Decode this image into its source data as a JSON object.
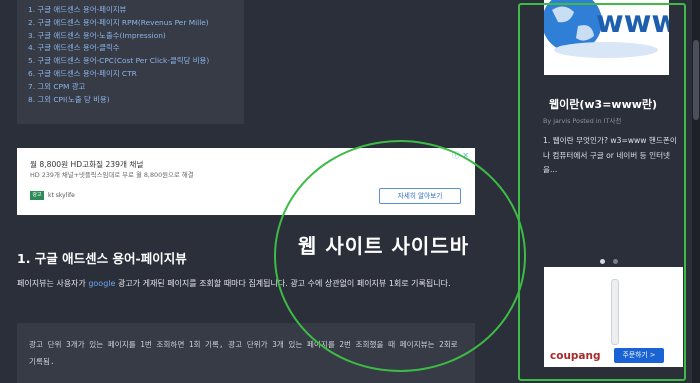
{
  "toc": {
    "items": [
      "1. 구글 애드센스 용어-페이지뷰",
      "2. 구글 애드센스 용어-페이지 RPM(Revenus Per Mille)",
      "3. 구글 애드센스 용어-노출수(Impression)",
      "4. 구글 애드센스 용어-클릭수",
      "5. 구글 애드센스 용어-CPC(Cost Per Click-클릭당 비용)",
      "6. 구글 애드센스 용어-페이지 CTR",
      "7. 그외 CPM 광고",
      "8. 그외 CPI(노출 당 비용)"
    ]
  },
  "ad": {
    "title": "월 8,800원 HD고화질 239개 채널",
    "desc": "HD 239개 채널+넷플릭스임대로 무료 월 8,800원으로 해결",
    "badge": "광고",
    "source": "kt skylife",
    "cta": "자세히 알아보기",
    "close": "ⓘ ✕"
  },
  "article": {
    "heading": "1. 구글 애드센스 용어-페이지뷰",
    "para_before": "페이지뷰는 사용자가 ",
    "para_link": "google",
    "para_after": " 광고가 게재된 페이지를 조회할 때마다 집계됩니다. 광고 수에 상관없이 페이지뷰 1회로 기록됩니다.",
    "quote": "광고 단위 3개가 있는 페이지를 1번 조회하면 1회 기록, 광고 단위가 3개 있는 페이지를 2번 조회했을 때 페이지뷰는 2회로 기록됨."
  },
  "sidebar": {
    "post_title": "웹이란(w3=www란)",
    "post_meta": "By jarvis Posted in IT사전",
    "excerpt": "1. 웹이란 무엇인가? w3=www 핸드폰이나 컴퓨터에서 구글 or 네이버 등 인터넷을...",
    "thumb_text": "www",
    "coupang_label": "coupang",
    "buy_label": "주문하기 >"
  },
  "annotation": {
    "label": "웹 사이트 사이드바",
    "color": "#3dbb45"
  },
  "colors": {
    "background": "#2b2f3a",
    "panel": "#363b46",
    "link": "#6ca6ee",
    "toc_link": "#8fb4e8"
  }
}
